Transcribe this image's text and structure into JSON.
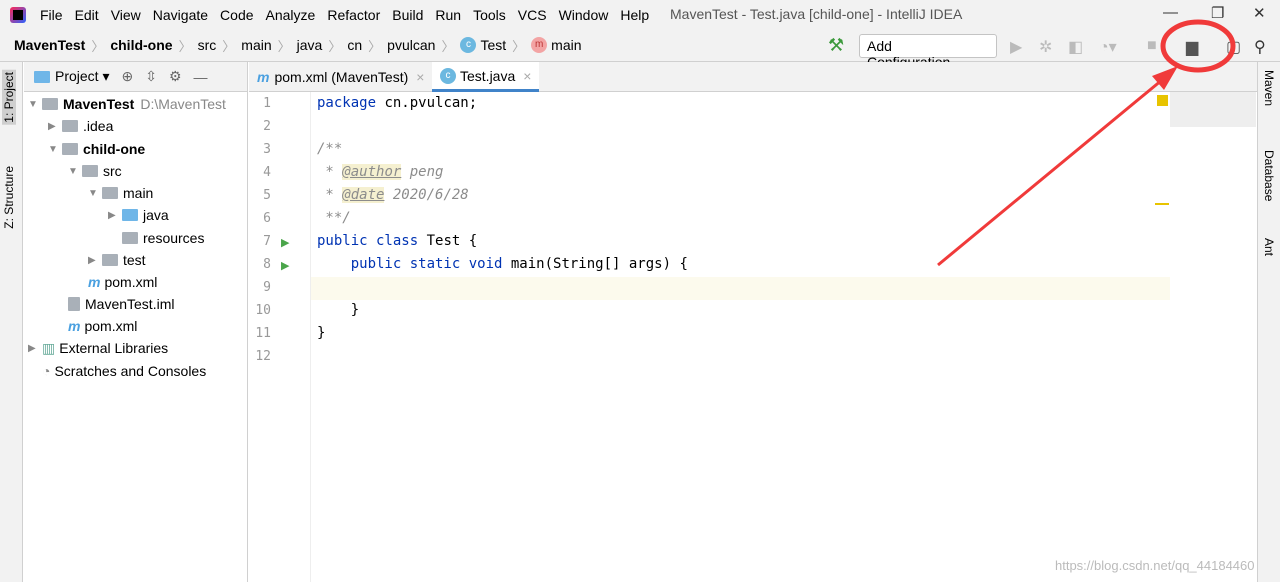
{
  "menu": [
    "File",
    "Edit",
    "View",
    "Navigate",
    "Code",
    "Analyze",
    "Refactor",
    "Build",
    "Run",
    "Tools",
    "VCS",
    "Window",
    "Help"
  ],
  "window_title": "MavenTest - Test.java [child-one] - IntelliJ IDEA",
  "breadcrumbs": [
    "MavenTest",
    "child-one",
    "src",
    "main",
    "java",
    "cn",
    "pvulcan",
    "Test",
    "main"
  ],
  "toolbar": {
    "add_configuration": "Add Configuration..."
  },
  "left_tabs": [
    "1: Project",
    "Z: Structure"
  ],
  "right_tabs": [
    "Maven",
    "Database",
    "Ant"
  ],
  "project_panel": {
    "title": "Project"
  },
  "tree": [
    {
      "label": "MavenTest",
      "extra": "D:\\MavenTest"
    },
    {
      "label": ".idea"
    },
    {
      "label": "child-one"
    },
    {
      "label": "src"
    },
    {
      "label": "main"
    },
    {
      "label": "java"
    },
    {
      "label": "resources"
    },
    {
      "label": "test"
    },
    {
      "label": "pom.xml"
    },
    {
      "label": "MavenTest.iml"
    },
    {
      "label": "pom.xml"
    },
    {
      "label": "External Libraries"
    },
    {
      "label": "Scratches and Consoles"
    }
  ],
  "tabs": [
    {
      "label": "pom.xml (MavenTest)"
    },
    {
      "label": "Test.java"
    }
  ],
  "code": {
    "lines": [
      "1",
      "2",
      "3",
      "4",
      "5",
      "6",
      "7",
      "8",
      "9",
      "10",
      "11",
      "12"
    ],
    "l1a": "package",
    "l1b": " cn.pvulcan;",
    "l3": "/**",
    "l4a": " * ",
    "l4b": "@author",
    "l4c": " peng",
    "l5a": " * ",
    "l5b": "@date",
    "l5c": " 2020/6/28",
    "l6": " **/",
    "l7a": "public class",
    "l7b": " Test {",
    "l8a": "    public static void",
    "l8b": " main(String[] args) {",
    "l10": "    }",
    "l11": "}"
  },
  "watermark": "https://blog.csdn.net/qq_44184460",
  "annotation_color": "#f03a3a"
}
